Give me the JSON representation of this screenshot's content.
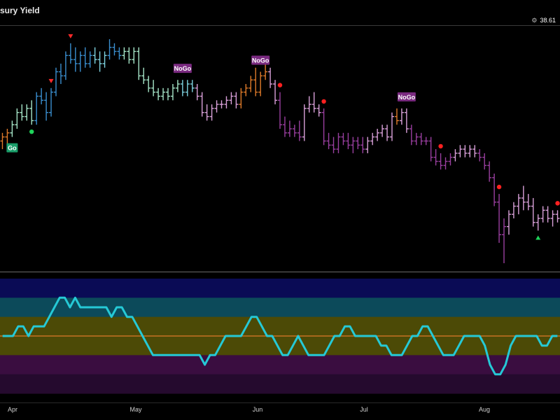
{
  "header": {
    "title": "sury Yield",
    "last_value": "38.61"
  },
  "chart_data": [
    {
      "type": "ohlc",
      "title": "sury Yield",
      "x_ticks": [
        "Apr",
        "May",
        "Jun",
        "Jul",
        "Aug"
      ],
      "colors": {
        "go": "#3a8fd0",
        "go_fade": "#7fd3e0",
        "go_weak": "#a6e6c8",
        "nogo": "#9a3fa0",
        "nogo_weak": "#d9a0d9",
        "amber": "#e07b2a"
      },
      "bars": [
        {
          "o": 3.1,
          "h": 3.3,
          "l": 2.9,
          "c": 3.2,
          "col": "amber"
        },
        {
          "o": 3.2,
          "h": 3.4,
          "l": 3.0,
          "c": 3.3,
          "col": "amber"
        },
        {
          "o": 3.3,
          "h": 3.6,
          "l": 3.2,
          "c": 3.5,
          "col": "go_weak"
        },
        {
          "o": 3.5,
          "h": 3.9,
          "l": 3.4,
          "c": 3.8,
          "col": "go_weak"
        },
        {
          "o": 3.8,
          "h": 4.0,
          "l": 3.6,
          "c": 3.7,
          "col": "go_weak"
        },
        {
          "o": 3.7,
          "h": 4.0,
          "l": 3.6,
          "c": 3.9,
          "col": "go_weak"
        },
        {
          "o": 3.9,
          "h": 4.1,
          "l": 3.5,
          "c": 3.6,
          "col": "go_weak"
        },
        {
          "o": 3.6,
          "h": 4.3,
          "l": 3.5,
          "c": 4.2,
          "col": "go"
        },
        {
          "o": 4.2,
          "h": 4.4,
          "l": 4.0,
          "c": 4.1,
          "col": "go"
        },
        {
          "o": 4.1,
          "h": 4.3,
          "l": 3.6,
          "c": 3.8,
          "col": "go"
        },
        {
          "o": 3.8,
          "h": 4.4,
          "l": 3.7,
          "c": 4.3,
          "col": "go"
        },
        {
          "o": 4.3,
          "h": 4.9,
          "l": 4.2,
          "c": 4.8,
          "col": "go"
        },
        {
          "o": 4.8,
          "h": 5.0,
          "l": 4.5,
          "c": 4.7,
          "col": "go"
        },
        {
          "o": 4.7,
          "h": 5.3,
          "l": 4.6,
          "c": 5.2,
          "col": "go"
        },
        {
          "o": 5.2,
          "h": 5.5,
          "l": 5.0,
          "c": 5.1,
          "col": "go"
        },
        {
          "o": 5.1,
          "h": 5.4,
          "l": 4.8,
          "c": 5.0,
          "col": "go"
        },
        {
          "o": 5.0,
          "h": 5.3,
          "l": 4.8,
          "c": 5.2,
          "col": "go"
        },
        {
          "o": 5.2,
          "h": 5.4,
          "l": 4.9,
          "c": 5.0,
          "col": "go"
        },
        {
          "o": 5.0,
          "h": 5.3,
          "l": 4.9,
          "c": 5.2,
          "col": "go"
        },
        {
          "o": 5.2,
          "h": 5.4,
          "l": 5.0,
          "c": 5.1,
          "col": "go_fade"
        },
        {
          "o": 5.1,
          "h": 5.3,
          "l": 4.8,
          "c": 5.0,
          "col": "go_fade"
        },
        {
          "o": 5.0,
          "h": 5.3,
          "l": 4.9,
          "c": 5.2,
          "col": "go_fade"
        },
        {
          "o": 5.2,
          "h": 5.6,
          "l": 5.1,
          "c": 5.4,
          "col": "go"
        },
        {
          "o": 5.4,
          "h": 5.5,
          "l": 5.2,
          "c": 5.3,
          "col": "go"
        },
        {
          "o": 5.3,
          "h": 5.4,
          "l": 5.1,
          "c": 5.2,
          "col": "go"
        },
        {
          "o": 5.2,
          "h": 5.4,
          "l": 5.1,
          "c": 5.3,
          "col": "go_weak"
        },
        {
          "o": 5.3,
          "h": 5.4,
          "l": 5.0,
          "c": 5.1,
          "col": "go_weak"
        },
        {
          "o": 5.1,
          "h": 5.4,
          "l": 5.0,
          "c": 5.3,
          "col": "go_weak"
        },
        {
          "o": 5.3,
          "h": 5.4,
          "l": 4.6,
          "c": 4.7,
          "col": "go_weak"
        },
        {
          "o": 4.7,
          "h": 4.9,
          "l": 4.5,
          "c": 4.6,
          "col": "go_weak"
        },
        {
          "o": 4.6,
          "h": 4.7,
          "l": 4.3,
          "c": 4.4,
          "col": "go_weak"
        },
        {
          "o": 4.4,
          "h": 4.6,
          "l": 4.2,
          "c": 4.3,
          "col": "go_weak"
        },
        {
          "o": 4.3,
          "h": 4.4,
          "l": 4.1,
          "c": 4.2,
          "col": "go_weak"
        },
        {
          "o": 4.2,
          "h": 4.4,
          "l": 4.1,
          "c": 4.3,
          "col": "go_weak"
        },
        {
          "o": 4.3,
          "h": 4.4,
          "l": 4.1,
          "c": 4.2,
          "col": "go_weak"
        },
        {
          "o": 4.2,
          "h": 4.5,
          "l": 4.1,
          "c": 4.4,
          "col": "go_weak"
        },
        {
          "o": 4.4,
          "h": 4.6,
          "l": 4.3,
          "c": 4.5,
          "col": "go_weak"
        },
        {
          "o": 4.5,
          "h": 4.6,
          "l": 4.2,
          "c": 4.3,
          "col": "go_fade"
        },
        {
          "o": 4.3,
          "h": 4.6,
          "l": 4.2,
          "c": 4.5,
          "col": "go_fade"
        },
        {
          "o": 4.5,
          "h": 4.6,
          "l": 4.3,
          "c": 4.4,
          "col": "go_fade"
        },
        {
          "o": 4.4,
          "h": 4.5,
          "l": 4.1,
          "c": 4.2,
          "col": "nogo_weak"
        },
        {
          "o": 4.2,
          "h": 4.3,
          "l": 3.7,
          "c": 3.8,
          "col": "nogo_weak"
        },
        {
          "o": 3.8,
          "h": 4.0,
          "l": 3.6,
          "c": 3.7,
          "col": "nogo_weak"
        },
        {
          "o": 3.7,
          "h": 4.0,
          "l": 3.6,
          "c": 3.9,
          "col": "nogo_weak"
        },
        {
          "o": 3.9,
          "h": 4.1,
          "l": 3.8,
          "c": 4.0,
          "col": "nogo_weak"
        },
        {
          "o": 4.0,
          "h": 4.1,
          "l": 3.9,
          "c": 4.0,
          "col": "nogo_weak"
        },
        {
          "o": 4.0,
          "h": 4.2,
          "l": 3.9,
          "c": 4.1,
          "col": "nogo_weak"
        },
        {
          "o": 4.1,
          "h": 4.3,
          "l": 4.0,
          "c": 4.2,
          "col": "nogo_weak"
        },
        {
          "o": 4.2,
          "h": 4.3,
          "l": 3.9,
          "c": 4.0,
          "col": "nogo_weak"
        },
        {
          "o": 4.0,
          "h": 4.4,
          "l": 3.9,
          "c": 4.3,
          "col": "amber"
        },
        {
          "o": 4.3,
          "h": 4.5,
          "l": 4.2,
          "c": 4.4,
          "col": "amber"
        },
        {
          "o": 4.4,
          "h": 4.7,
          "l": 4.3,
          "c": 4.6,
          "col": "amber"
        },
        {
          "o": 4.6,
          "h": 4.9,
          "l": 4.2,
          "c": 4.3,
          "col": "amber"
        },
        {
          "o": 4.3,
          "h": 4.8,
          "l": 4.2,
          "c": 4.7,
          "col": "amber"
        },
        {
          "o": 4.7,
          "h": 5.0,
          "l": 4.6,
          "c": 4.8,
          "col": "amber"
        },
        {
          "o": 4.8,
          "h": 4.9,
          "l": 4.4,
          "c": 4.5,
          "col": "nogo_weak"
        },
        {
          "o": 4.5,
          "h": 4.6,
          "l": 4.0,
          "c": 4.1,
          "col": "nogo_weak"
        },
        {
          "o": 4.1,
          "h": 4.3,
          "l": 3.4,
          "c": 3.5,
          "col": "nogo"
        },
        {
          "o": 3.5,
          "h": 3.7,
          "l": 3.2,
          "c": 3.3,
          "col": "nogo"
        },
        {
          "o": 3.3,
          "h": 3.6,
          "l": 3.2,
          "c": 3.4,
          "col": "nogo"
        },
        {
          "o": 3.4,
          "h": 3.5,
          "l": 3.2,
          "c": 3.3,
          "col": "nogo"
        },
        {
          "o": 3.3,
          "h": 3.6,
          "l": 3.1,
          "c": 3.2,
          "col": "nogo"
        },
        {
          "o": 3.2,
          "h": 4.0,
          "l": 3.1,
          "c": 3.9,
          "col": "nogo_weak"
        },
        {
          "o": 3.9,
          "h": 4.2,
          "l": 3.8,
          "c": 4.0,
          "col": "nogo_weak"
        },
        {
          "o": 4.0,
          "h": 4.3,
          "l": 3.8,
          "c": 3.9,
          "col": "nogo_weak"
        },
        {
          "o": 3.9,
          "h": 4.0,
          "l": 3.7,
          "c": 3.8,
          "col": "nogo_weak"
        },
        {
          "o": 3.8,
          "h": 3.9,
          "l": 3.0,
          "c": 3.1,
          "col": "nogo"
        },
        {
          "o": 3.1,
          "h": 3.3,
          "l": 2.9,
          "c": 3.0,
          "col": "nogo"
        },
        {
          "o": 3.0,
          "h": 3.2,
          "l": 2.8,
          "c": 2.9,
          "col": "nogo"
        },
        {
          "o": 2.9,
          "h": 3.3,
          "l": 2.8,
          "c": 3.2,
          "col": "nogo"
        },
        {
          "o": 3.2,
          "h": 3.3,
          "l": 3.0,
          "c": 3.1,
          "col": "nogo"
        },
        {
          "o": 3.1,
          "h": 3.3,
          "l": 2.9,
          "c": 3.0,
          "col": "nogo"
        },
        {
          "o": 3.0,
          "h": 3.2,
          "l": 2.8,
          "c": 3.1,
          "col": "nogo"
        },
        {
          "o": 3.1,
          "h": 3.2,
          "l": 2.9,
          "c": 3.0,
          "col": "nogo"
        },
        {
          "o": 3.0,
          "h": 3.2,
          "l": 2.8,
          "c": 2.9,
          "col": "nogo"
        },
        {
          "o": 2.9,
          "h": 3.2,
          "l": 2.8,
          "c": 3.1,
          "col": "nogo_weak"
        },
        {
          "o": 3.1,
          "h": 3.3,
          "l": 3.0,
          "c": 3.2,
          "col": "nogo_weak"
        },
        {
          "o": 3.2,
          "h": 3.4,
          "l": 3.1,
          "c": 3.3,
          "col": "nogo_weak"
        },
        {
          "o": 3.3,
          "h": 3.5,
          "l": 3.2,
          "c": 3.4,
          "col": "nogo_weak"
        },
        {
          "o": 3.4,
          "h": 3.5,
          "l": 3.1,
          "c": 3.2,
          "col": "nogo_weak"
        },
        {
          "o": 3.2,
          "h": 3.8,
          "l": 3.1,
          "c": 3.7,
          "col": "nogo_weak"
        },
        {
          "o": 3.7,
          "h": 3.9,
          "l": 3.5,
          "c": 3.6,
          "col": "amber"
        },
        {
          "o": 3.6,
          "h": 3.9,
          "l": 3.5,
          "c": 3.8,
          "col": "nogo_weak"
        },
        {
          "o": 3.8,
          "h": 3.9,
          "l": 3.3,
          "c": 3.4,
          "col": "nogo_weak"
        },
        {
          "o": 3.4,
          "h": 3.5,
          "l": 3.0,
          "c": 3.1,
          "col": "nogo"
        },
        {
          "o": 3.1,
          "h": 3.3,
          "l": 3.0,
          "c": 3.2,
          "col": "nogo"
        },
        {
          "o": 3.2,
          "h": 3.3,
          "l": 3.0,
          "c": 3.1,
          "col": "nogo"
        },
        {
          "o": 3.1,
          "h": 3.2,
          "l": 3.0,
          "c": 3.1,
          "col": "nogo"
        },
        {
          "o": 3.1,
          "h": 3.2,
          "l": 2.6,
          "c": 2.7,
          "col": "nogo"
        },
        {
          "o": 2.7,
          "h": 2.9,
          "l": 2.5,
          "c": 2.6,
          "col": "nogo"
        },
        {
          "o": 2.6,
          "h": 2.8,
          "l": 2.4,
          "c": 2.5,
          "col": "nogo"
        },
        {
          "o": 2.5,
          "h": 2.7,
          "l": 2.4,
          "c": 2.6,
          "col": "nogo"
        },
        {
          "o": 2.6,
          "h": 2.8,
          "l": 2.5,
          "c": 2.7,
          "col": "nogo"
        },
        {
          "o": 2.7,
          "h": 2.9,
          "l": 2.6,
          "c": 2.8,
          "col": "nogo_weak"
        },
        {
          "o": 2.8,
          "h": 3.0,
          "l": 2.7,
          "c": 2.9,
          "col": "nogo_weak"
        },
        {
          "o": 2.9,
          "h": 3.0,
          "l": 2.7,
          "c": 2.8,
          "col": "nogo_weak"
        },
        {
          "o": 2.8,
          "h": 3.0,
          "l": 2.7,
          "c": 2.9,
          "col": "nogo_weak"
        },
        {
          "o": 2.9,
          "h": 3.0,
          "l": 2.7,
          "c": 2.8,
          "col": "nogo_weak"
        },
        {
          "o": 2.8,
          "h": 2.9,
          "l": 2.6,
          "c": 2.7,
          "col": "nogo"
        },
        {
          "o": 2.7,
          "h": 2.8,
          "l": 2.4,
          "c": 2.5,
          "col": "nogo"
        },
        {
          "o": 2.5,
          "h": 2.6,
          "l": 2.1,
          "c": 2.2,
          "col": "nogo"
        },
        {
          "o": 2.2,
          "h": 2.3,
          "l": 1.5,
          "c": 1.6,
          "col": "nogo"
        },
        {
          "o": 1.6,
          "h": 1.8,
          "l": 0.6,
          "c": 0.8,
          "col": "nogo"
        },
        {
          "o": 0.8,
          "h": 1.2,
          "l": 0.1,
          "c": 1.0,
          "col": "nogo"
        },
        {
          "o": 1.0,
          "h": 1.4,
          "l": 0.8,
          "c": 1.3,
          "col": "nogo_weak"
        },
        {
          "o": 1.3,
          "h": 1.6,
          "l": 1.2,
          "c": 1.5,
          "col": "nogo_weak"
        },
        {
          "o": 1.5,
          "h": 1.8,
          "l": 1.3,
          "c": 1.7,
          "col": "nogo_weak"
        },
        {
          "o": 1.7,
          "h": 2.0,
          "l": 1.4,
          "c": 1.6,
          "col": "nogo_weak"
        },
        {
          "o": 1.6,
          "h": 1.8,
          "l": 1.4,
          "c": 1.5,
          "col": "nogo_weak"
        },
        {
          "o": 1.5,
          "h": 1.7,
          "l": 1.0,
          "c": 1.1,
          "col": "nogo_weak"
        },
        {
          "o": 1.1,
          "h": 1.3,
          "l": 0.9,
          "c": 1.2,
          "col": "nogo_weak"
        },
        {
          "o": 1.2,
          "h": 1.5,
          "l": 1.1,
          "c": 1.4,
          "col": "nogo_weak"
        },
        {
          "o": 1.4,
          "h": 1.5,
          "l": 1.1,
          "c": 1.2,
          "col": "nogo_weak"
        },
        {
          "o": 1.2,
          "h": 1.4,
          "l": 1.0,
          "c": 1.3,
          "col": "nogo_weak"
        },
        {
          "o": 1.3,
          "h": 1.4,
          "l": 1.1,
          "c": 1.2,
          "col": "nogo_weak"
        }
      ],
      "signals": [
        {
          "label": "Go",
          "bar": 2,
          "side": "below",
          "kind": "go"
        },
        {
          "label": "NoGo",
          "bar": 37,
          "side": "above",
          "kind": "nogo"
        },
        {
          "label": "NoGo",
          "bar": 53,
          "side": "above",
          "kind": "nogo"
        },
        {
          "label": "NoGo",
          "bar": 83,
          "side": "above",
          "kind": "nogo"
        }
      ],
      "markers": [
        {
          "shape": "circle",
          "color": "#1fd35a",
          "bar": 6,
          "side": "below"
        },
        {
          "shape": "tri-down",
          "color": "#ff2a2a",
          "bar": 10,
          "side": "above"
        },
        {
          "shape": "tri-down",
          "color": "#ff2a2a",
          "bar": 14,
          "side": "above"
        },
        {
          "shape": "circle",
          "color": "#ff2020",
          "bar": 57,
          "side": "above"
        },
        {
          "shape": "circle",
          "color": "#ff2020",
          "bar": 66,
          "side": "above"
        },
        {
          "shape": "circle",
          "color": "#ff2020",
          "bar": 90,
          "side": "above"
        },
        {
          "shape": "circle",
          "color": "#ff2020",
          "bar": 102,
          "side": "above"
        },
        {
          "shape": "tri-up",
          "color": "#1fd35a",
          "bar": 110,
          "side": "below"
        },
        {
          "shape": "circle",
          "color": "#ff2020",
          "bar": 114,
          "side": "above"
        },
        {
          "shape": "circle",
          "color": "#ff2020",
          "bar": 122,
          "side": "above"
        }
      ]
    },
    {
      "type": "line",
      "name": "oscillator",
      "ylim": [
        -6,
        6
      ],
      "zero_line_color": "#e07b2a",
      "line_color": "#25c9d6",
      "band_colors": [
        "#0a0b55",
        "#0c4a5a",
        "#4c4a06",
        "#4c4a06",
        "#3a0d40",
        "#250a2e"
      ],
      "values": [
        0,
        0,
        0,
        1,
        1,
        0,
        1,
        1,
        1,
        2,
        3,
        4,
        4,
        3,
        4,
        3,
        3,
        3,
        3,
        3,
        3,
        2,
        3,
        3,
        2,
        2,
        1,
        0,
        -1,
        -2,
        -2,
        -2,
        -2,
        -2,
        -2,
        -2,
        -2,
        -2,
        -2,
        -3,
        -2,
        -2,
        -1,
        0,
        0,
        0,
        0,
        1,
        2,
        2,
        1,
        0,
        0,
        -1,
        -2,
        -2,
        -1,
        0,
        -1,
        -2,
        -2,
        -2,
        -2,
        -1,
        0,
        0,
        1,
        1,
        0,
        0,
        0,
        0,
        0,
        -1,
        -1,
        -2,
        -2,
        -2,
        -1,
        0,
        0,
        1,
        1,
        0,
        -1,
        -2,
        -2,
        -2,
        -1,
        0,
        0,
        0,
        0,
        -1,
        -3,
        -4,
        -4,
        -3,
        -1,
        0,
        0,
        0,
        0,
        0,
        -1,
        -1,
        0,
        0
      ]
    }
  ]
}
